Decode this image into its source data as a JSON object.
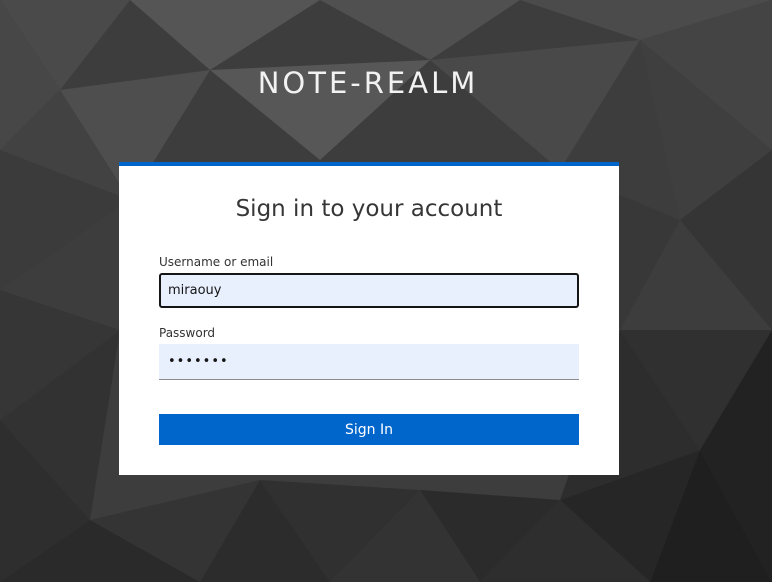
{
  "realm": {
    "title": "NOTE-REALM"
  },
  "login": {
    "heading": "Sign in to your account",
    "username_label": "Username or email",
    "username_value": "miraouy",
    "password_label": "Password",
    "password_value": "•••••••",
    "submit_label": "Sign In"
  },
  "colors": {
    "accent": "#0066cc",
    "input_background": "#e8f0fe",
    "card_background": "#ffffff",
    "page_background": "#3a3a3a"
  }
}
